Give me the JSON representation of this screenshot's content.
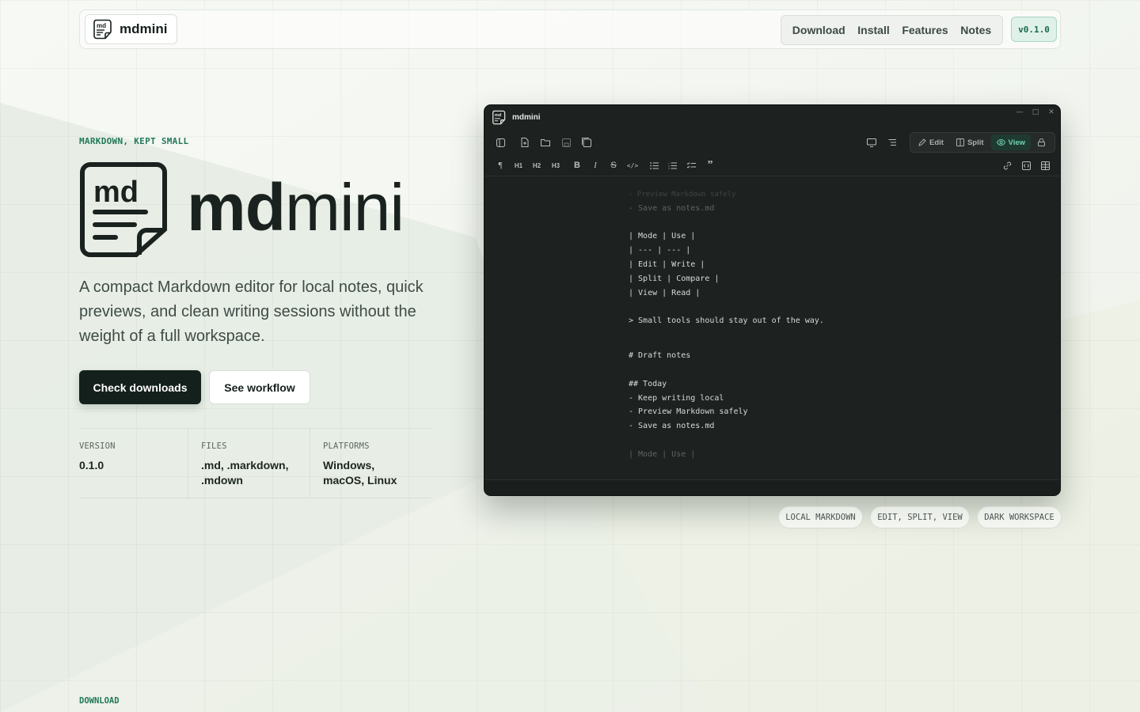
{
  "header": {
    "brand_name": "mdmini",
    "nav": [
      "Download",
      "Install",
      "Features",
      "Notes"
    ],
    "version_badge": "v0.1.0"
  },
  "hero": {
    "eyebrow": "MARKDOWN, KEPT SMALL",
    "wordmark_bold": "md",
    "wordmark_light": "mini",
    "tagline": "A compact Markdown editor for local notes, quick previews, and clean writing sessions without the weight of a full workspace.",
    "primary_cta": "Check downloads",
    "secondary_cta": "See workflow",
    "meta": [
      {
        "label": "VERSION",
        "value": "0.1.0"
      },
      {
        "label": "FILES",
        "value": ".md, .markdown, .mdown"
      },
      {
        "label": "PLATFORMS",
        "value": "Windows, macOS, Linux"
      }
    ]
  },
  "app_window": {
    "title": "mdmini",
    "modes": {
      "edit": "Edit",
      "split": "Split",
      "view": "View",
      "active": "view"
    },
    "editor_lines": [
      "- Save as notes.md",
      "",
      "| Mode | Use |",
      "| --- | --- |",
      "| Edit | Write |",
      "| Split | Compare |",
      "| View | Read |",
      "",
      "> Small tools should stay out of the way.",
      "",
      "# Draft notes",
      "",
      "## Today",
      "- Keep writing local",
      "- Preview Markdown safely",
      "- Save as notes.md",
      "",
      "| Mode | Use |"
    ]
  },
  "chips": [
    "LOCAL MARKDOWN",
    "EDIT, SPLIT, VIEW",
    "DARK WORKSPACE"
  ],
  "next_section_label": "DOWNLOAD",
  "colors": {
    "accent": "#22795b",
    "dark": "#14201b",
    "editor_bg": "#1d211f",
    "active_mode": "#6fd3ad"
  }
}
